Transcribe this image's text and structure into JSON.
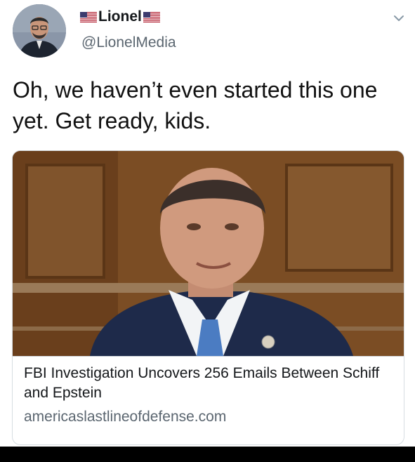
{
  "author": {
    "display_name": "Lionel",
    "handle": "@LionelMedia",
    "name_emoji_icon": "us-flag-icon"
  },
  "tweet": {
    "text": "Oh, we haven’t even started this one yet. Get ready, kids."
  },
  "card": {
    "title": "FBI Investigation Uncovers 256 Emails Between Schiff and Epstein",
    "domain": "americaslastlineofdefense.com"
  },
  "icons": {
    "menu": "chevron-down-icon"
  },
  "colors": {
    "text": "#14171a",
    "secondary_text": "#5b6670",
    "card_border": "#d7dde2"
  }
}
